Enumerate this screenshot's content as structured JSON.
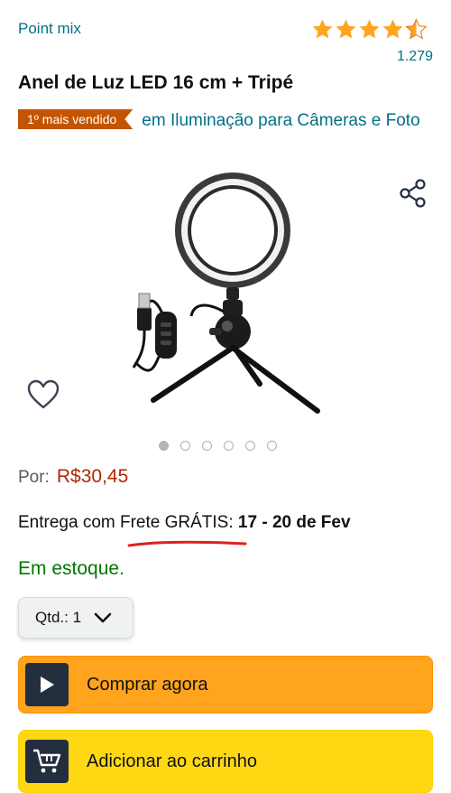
{
  "header": {
    "brand": "Point mix",
    "rating": 4.5,
    "rating_count": "1.279"
  },
  "product": {
    "title": "Anel de Luz LED 16 cm + Tripé",
    "badge": "1º mais vendido",
    "category": "em Iluminação para Câmeras e Foto"
  },
  "gallery": {
    "image_count": 6,
    "active_index": 0
  },
  "price": {
    "label": "Por:",
    "value": "R$30,45"
  },
  "delivery": {
    "prefix": "Entrega com Frete GRÁTIS:",
    "dates": "17 - 20 de Fev"
  },
  "stock": "Em estoque.",
  "quantity": {
    "label": "Qtd.:",
    "value": "1"
  },
  "buttons": {
    "buy_now": "Comprar agora",
    "add_to_cart": "Adicionar ao carrinho"
  },
  "colors": {
    "link": "#007185",
    "star": "#ffa41c",
    "badge": "#c45500",
    "price": "#b12704",
    "stock": "#007600",
    "buy_button": "#ffa41c",
    "cart_button": "#ffd814",
    "annotation": "#e02020"
  },
  "icons": {
    "share": "share-icon",
    "wishlist": "heart-icon",
    "buy": "play-icon",
    "cart": "cart-icon"
  }
}
